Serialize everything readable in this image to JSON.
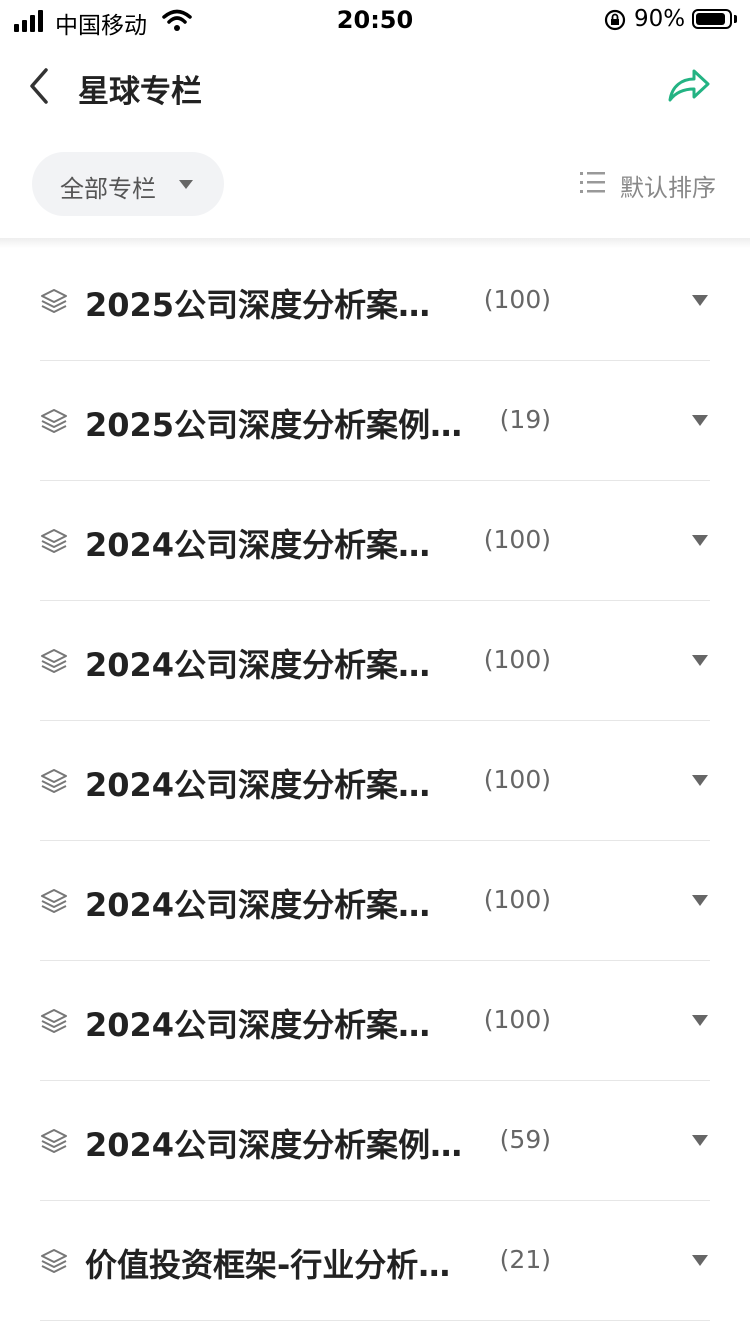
{
  "status_bar": {
    "carrier": "中国移动",
    "time": "20:50",
    "battery": "90%",
    "battery_level": 0.9
  },
  "nav": {
    "title": "星球专栏"
  },
  "filter": {
    "label": "全部专栏",
    "sort_label": "默认排序"
  },
  "columns": [
    {
      "title": "2025公司深度分析案…",
      "count": "(100)"
    },
    {
      "title": "2025公司深度分析案例…",
      "count": "(19)"
    },
    {
      "title": "2024公司深度分析案…",
      "count": "(100)"
    },
    {
      "title": "2024公司深度分析案…",
      "count": "(100)"
    },
    {
      "title": "2024公司深度分析案…",
      "count": "(100)"
    },
    {
      "title": "2024公司深度分析案…",
      "count": "(100)"
    },
    {
      "title": "2024公司深度分析案…",
      "count": "(100)"
    },
    {
      "title": "2024公司深度分析案例…",
      "count": "(59)"
    },
    {
      "title": "价值投资框架-行业分析…",
      "count": "(21)"
    }
  ],
  "colors": {
    "accent": "#23b383"
  }
}
